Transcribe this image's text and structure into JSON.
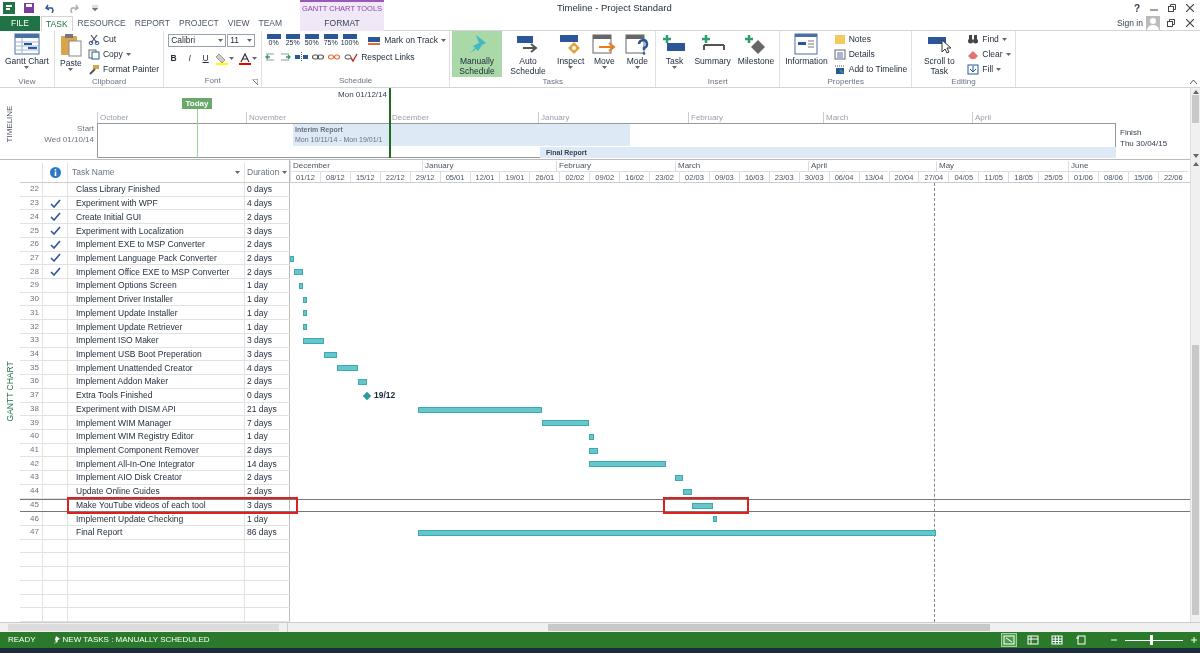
{
  "window": {
    "title": "Timeline - Project Standard",
    "help": "?"
  },
  "contextual_header": "GANTT CHART TOOLS",
  "account": {
    "sign_in": "Sign in"
  },
  "ribbon_tabs": [
    {
      "label": "FILE",
      "kind": "file",
      "selected": false
    },
    {
      "label": "TASK",
      "kind": "tab",
      "selected": true
    },
    {
      "label": "RESOURCE",
      "kind": "tab",
      "selected": false
    },
    {
      "label": "REPORT",
      "kind": "tab",
      "selected": false
    },
    {
      "label": "PROJECT",
      "kind": "tab",
      "selected": false
    },
    {
      "label": "VIEW",
      "kind": "tab",
      "selected": false
    },
    {
      "label": "TEAM",
      "kind": "tab",
      "selected": false
    },
    {
      "label": "FORMAT",
      "kind": "contextual",
      "selected": false
    }
  ],
  "ribbon": [
    {
      "label": "View",
      "kind": "standard",
      "items": [
        {
          "kind": "large",
          "label": "Gantt Chart",
          "dropdown": true
        }
      ]
    },
    {
      "label": "Clipboard",
      "kind": "standard",
      "items": [
        {
          "kind": "large",
          "label": "Paste",
          "dropdown": true
        },
        {
          "kind": "small",
          "label": "Cut",
          "dropdown": false
        },
        {
          "kind": "small",
          "label": "Copy",
          "dropdown": true
        },
        {
          "kind": "small",
          "label": "Format Painter",
          "dropdown": false
        }
      ]
    },
    {
      "label": "Font",
      "kind": "font",
      "font": "Calibri",
      "size": "11",
      "styles": [
        "B",
        "I",
        "U"
      ]
    },
    {
      "label": "Schedule",
      "kind": "schedule",
      "percents": [
        "0%",
        "25%",
        "50%",
        "75%",
        "100%"
      ],
      "items": [
        {
          "kind": "small",
          "label": "Mark on Track",
          "dropdown": true
        },
        {
          "kind": "small",
          "label": "Respect Links",
          "dropdown": false
        }
      ]
    },
    {
      "label": "Tasks",
      "kind": "standard",
      "items": [
        {
          "kind": "large",
          "label": "Manually Schedule",
          "dropdown": false,
          "selected": true
        },
        {
          "kind": "large",
          "label": "Auto Schedule",
          "dropdown": false,
          "selected": false
        },
        {
          "kind": "large",
          "label": "Inspect",
          "dropdown": true,
          "selected": false
        },
        {
          "kind": "large",
          "label": "Move",
          "dropdown": true,
          "selected": false
        },
        {
          "kind": "large",
          "label": "Mode",
          "dropdown": true,
          "selected": false
        }
      ]
    },
    {
      "label": "Insert",
      "kind": "standard",
      "items": [
        {
          "kind": "large",
          "label": "Task",
          "dropdown": true
        },
        {
          "kind": "large",
          "label": "Summary",
          "dropdown": false
        },
        {
          "kind": "large",
          "label": "Milestone",
          "dropdown": false
        }
      ]
    },
    {
      "label": "Properties",
      "kind": "standard",
      "items": [
        {
          "kind": "large",
          "label": "Information",
          "dropdown": false
        },
        {
          "kind": "small",
          "label": "Notes",
          "dropdown": false
        },
        {
          "kind": "small",
          "label": "Details",
          "dropdown": false
        },
        {
          "kind": "small",
          "label": "Add to Timeline",
          "dropdown": false
        }
      ]
    },
    {
      "label": "Editing",
      "kind": "standard",
      "items": [
        {
          "kind": "large",
          "label": "Scroll to Task",
          "dropdown": false
        },
        {
          "kind": "small",
          "label": "Find",
          "dropdown": true
        },
        {
          "kind": "small",
          "label": "Clear",
          "dropdown": true
        },
        {
          "kind": "small",
          "label": "Fill",
          "dropdown": true
        }
      ]
    }
  ],
  "timeline": {
    "label": "TIMELINE",
    "start_label": "Start",
    "start_date": "Wed 01/10/14",
    "finish_label": "Finish",
    "finish_date": "Thu 30/04/15",
    "today": {
      "label": "Today"
    },
    "current": {
      "label": "Mon 01/12/14"
    },
    "months": [
      "October",
      "November",
      "December",
      "January",
      "February",
      "March",
      "April"
    ],
    "bars": [
      {
        "name": "Interim Report",
        "dates": "Mon 10/11/14 - Mon 19/01/1"
      },
      {
        "name": "Final Report"
      }
    ]
  },
  "table": {
    "view_label": "GANTT CHART",
    "columns": [
      "Task Name",
      "Duration"
    ]
  },
  "tasks": [
    {
      "id": "22",
      "name": "Class Library Finished",
      "duration": "0 days",
      "done": false,
      "selected": false,
      "highlighted": false
    },
    {
      "id": "23",
      "name": "Experiment with WPF",
      "duration": "4 days",
      "done": true,
      "selected": false,
      "highlighted": false
    },
    {
      "id": "24",
      "name": "Create Initial GUI",
      "duration": "2 days",
      "done": true,
      "selected": false,
      "highlighted": false
    },
    {
      "id": "25",
      "name": "Experiment with Localization",
      "duration": "3 days",
      "done": true,
      "selected": false,
      "highlighted": false
    },
    {
      "id": "26",
      "name": "Implement EXE to MSP Converter",
      "duration": "2 days",
      "done": true,
      "selected": false,
      "highlighted": false
    },
    {
      "id": "27",
      "name": "Implement Language Pack Converter",
      "duration": "2 days",
      "done": true,
      "selected": false,
      "highlighted": false,
      "bar": {
        "kind": "task"
      }
    },
    {
      "id": "28",
      "name": "Implement Office EXE to MSP Converter",
      "duration": "2 days",
      "done": true,
      "selected": false,
      "highlighted": false,
      "bar": {
        "kind": "task"
      }
    },
    {
      "id": "29",
      "name": "Implement Options Screen",
      "duration": "1 day",
      "done": false,
      "selected": false,
      "highlighted": false,
      "bar": {
        "kind": "task"
      }
    },
    {
      "id": "30",
      "name": "Implement Driver Installer",
      "duration": "1 day",
      "done": false,
      "selected": false,
      "highlighted": false,
      "bar": {
        "kind": "task"
      }
    },
    {
      "id": "31",
      "name": "Implement Update Installer",
      "duration": "1 day",
      "done": false,
      "selected": false,
      "highlighted": false,
      "bar": {
        "kind": "task"
      }
    },
    {
      "id": "32",
      "name": "Implement Update Retriever",
      "duration": "1 day",
      "done": false,
      "selected": false,
      "highlighted": false,
      "bar": {
        "kind": "task"
      }
    },
    {
      "id": "33",
      "name": "Implement ISO Maker",
      "duration": "3 days",
      "done": false,
      "selected": false,
      "highlighted": false,
      "bar": {
        "kind": "task"
      }
    },
    {
      "id": "34",
      "name": "Implement USB Boot Preperation",
      "duration": "3 days",
      "done": false,
      "selected": false,
      "highlighted": false,
      "bar": {
        "kind": "task"
      }
    },
    {
      "id": "35",
      "name": "Implement Unattended Creator",
      "duration": "4 days",
      "done": false,
      "selected": false,
      "highlighted": false,
      "bar": {
        "kind": "task"
      }
    },
    {
      "id": "36",
      "name": "Implement Addon Maker",
      "duration": "2 days",
      "done": false,
      "selected": false,
      "highlighted": false,
      "bar": {
        "kind": "task"
      }
    },
    {
      "id": "37",
      "name": "Extra Tools Finished",
      "duration": "0 days",
      "done": false,
      "selected": false,
      "highlighted": false,
      "bar": {
        "kind": "milestone",
        "label": "19/12"
      }
    },
    {
      "id": "38",
      "name": "Experiment with DISM API",
      "duration": "21 days",
      "done": false,
      "selected": false,
      "highlighted": false,
      "bar": {
        "kind": "task"
      }
    },
    {
      "id": "39",
      "name": "Implement WIM Manager",
      "duration": "7 days",
      "done": false,
      "selected": false,
      "highlighted": false,
      "bar": {
        "kind": "task"
      }
    },
    {
      "id": "40",
      "name": "Implement WIM Registry Editor",
      "duration": "1 day",
      "done": false,
      "selected": false,
      "highlighted": false,
      "bar": {
        "kind": "task"
      }
    },
    {
      "id": "41",
      "name": "Implement Component Remover",
      "duration": "2 days",
      "done": false,
      "selected": false,
      "highlighted": false,
      "bar": {
        "kind": "task"
      }
    },
    {
      "id": "42",
      "name": "Implement All-In-One Integrator",
      "duration": "14 days",
      "done": false,
      "selected": false,
      "highlighted": false,
      "bar": {
        "kind": "task"
      }
    },
    {
      "id": "43",
      "name": "Implement AIO Disk Creator",
      "duration": "2 days",
      "done": false,
      "selected": false,
      "highlighted": false,
      "bar": {
        "kind": "task"
      }
    },
    {
      "id": "44",
      "name": "Update Online Guides",
      "duration": "2 days",
      "done": false,
      "selected": false,
      "highlighted": false,
      "bar": {
        "kind": "task"
      }
    },
    {
      "id": "45",
      "name": "Make YouTube videos of each tool",
      "duration": "3 days",
      "done": false,
      "selected": true,
      "highlighted": true,
      "bar": {
        "kind": "task"
      }
    },
    {
      "id": "46",
      "name": "Implement Update Checking",
      "duration": "1 day",
      "done": false,
      "selected": false,
      "highlighted": false,
      "bar": {
        "kind": "task"
      }
    },
    {
      "id": "47",
      "name": "Final Report",
      "duration": "86 days",
      "done": false,
      "selected": false,
      "highlighted": false,
      "bar": {
        "kind": "task"
      }
    }
  ],
  "gantt": {
    "months": [
      "December",
      "January",
      "February",
      "March",
      "April",
      "May",
      "June"
    ],
    "weeks": [
      "01/12",
      "08/12",
      "15/12",
      "22/12",
      "29/12",
      "05/01",
      "12/01",
      "19/01",
      "26/01",
      "02/02",
      "09/02",
      "16/02",
      "23/02",
      "02/03",
      "09/03",
      "16/03",
      "23/03",
      "30/03",
      "06/04",
      "13/04",
      "20/04",
      "27/04",
      "04/05",
      "11/05",
      "18/05",
      "25/05",
      "01/06",
      "08/06",
      "15/06",
      "22/06"
    ]
  },
  "status_bar": {
    "ready": "READY",
    "new_tasks": "NEW TASKS : MANUALLY SCHEDULED",
    "views": [
      {
        "selected": true
      },
      {
        "selected": false
      },
      {
        "selected": false
      },
      {
        "selected": false
      }
    ],
    "zoom": {
      "level": 0.45
    }
  }
}
